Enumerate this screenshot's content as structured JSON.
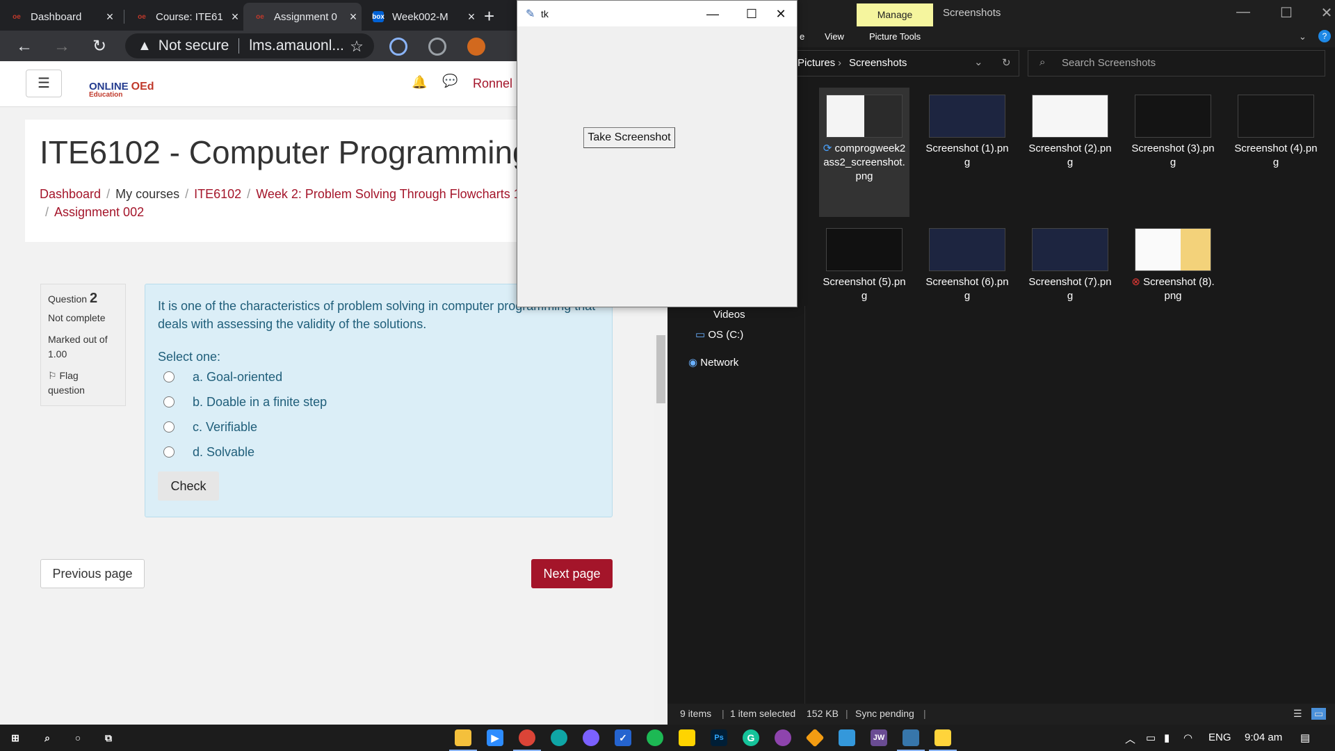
{
  "browser": {
    "tabs": [
      {
        "title": "Dashboard",
        "favicon": "oed"
      },
      {
        "title": "Course: ITE61",
        "favicon": "oed"
      },
      {
        "title": "Assignment 0",
        "favicon": "oed",
        "active": true
      },
      {
        "title": "Week002-M",
        "favicon": "box"
      }
    ],
    "security_label": "Not secure",
    "url": "lms.amauonl..."
  },
  "lms": {
    "logo": {
      "main": "ONLINE",
      "sub": "Education",
      "badge": "OEd"
    },
    "user": "Ronnel",
    "page_title": "ITE6102 - Computer Programming",
    "breadcrumb": [
      "Dashboard",
      "My courses",
      "ITE6102",
      "Week 2: Problem Solving Through Flowcharts 1",
      "Assignment 002"
    ],
    "question": {
      "label": "Question",
      "number": "2",
      "status": "Not complete",
      "marked_out_of": "Marked out of",
      "marks": "1.00",
      "flag_label": "Flag",
      "flag_label2": "question",
      "text": "It is one of the characteristics of problem solving in computer programming that deals with assessing the validity of the solutions.",
      "select_label": "Select one:",
      "options": [
        "a. Goal-oriented",
        "b. Doable in a finite step",
        "c. Verifiable",
        "d. Solvable"
      ],
      "check_label": "Check"
    },
    "prev_label": "Previous page",
    "next_label": "Next page",
    "accent": "#a4152a"
  },
  "tk": {
    "title": "tk",
    "button_label": "Take Screenshot"
  },
  "explorer": {
    "manage_label": "Manage",
    "window_title": "Screenshots",
    "ribbon": {
      "view": "View",
      "picture_tools": "Picture Tools",
      "partial": "e"
    },
    "address": {
      "parent": "Pictures",
      "current": "Screenshots"
    },
    "search_placeholder": "Search Screenshots",
    "nav": {
      "videos": "Videos",
      "os": "OS (C:)",
      "network": "Network"
    },
    "files": [
      {
        "name": "comprogweek2ass2_screenshot.png",
        "status": "syncing"
      },
      {
        "name": "Screenshot (1).png"
      },
      {
        "name": "Screenshot (2).png"
      },
      {
        "name": "Screenshot (3).png"
      },
      {
        "name": "Screenshot (4).png"
      },
      {
        "name": "Screenshot (5).png"
      },
      {
        "name": "Screenshot (6).png"
      },
      {
        "name": "Screenshot (7).png"
      },
      {
        "name": "Screenshot (8).png",
        "status": "error"
      }
    ],
    "status": {
      "items": "9 items",
      "selected": "1 item selected",
      "size": "152 KB",
      "sync": "Sync pending"
    }
  },
  "taskbar": {
    "language": "ENG",
    "time": "9:04 am"
  }
}
